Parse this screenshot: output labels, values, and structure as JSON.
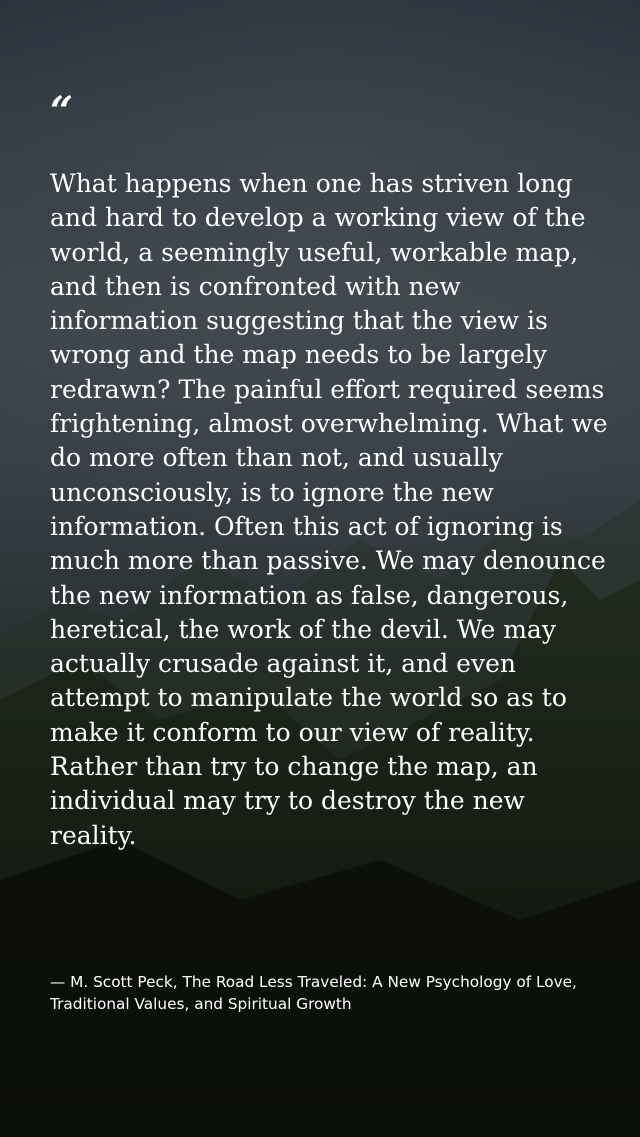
{
  "quote": {
    "mark": "“",
    "text": "What happens when one has striven long and hard to develop a working view of the world, a seemingly useful, workable map, and then is confronted with new information suggesting that the view is wrong and the map needs to be largely redrawn? The painful effort required seems frightening, almost overwhelming. What we do more often than not, and usually unconsciously, is to ignore the new information. Often this act of ignoring is much more than passive. We may denounce the new information as false, dangerous, heretical, the work of the devil. We may actually crusade against it, and even attempt to manipulate the world so as to make it conform to our view of reality. Rather than try to change the map, an individual may try to destroy the new reality.",
    "attribution": "— M. Scott Peck, The Road Less Traveled: A New Psychology of Love, Traditional Values, and Spiritual Growth"
  },
  "colors": {
    "text": "#ffffff",
    "sky": "#56606b",
    "hills": "#1c2419"
  }
}
